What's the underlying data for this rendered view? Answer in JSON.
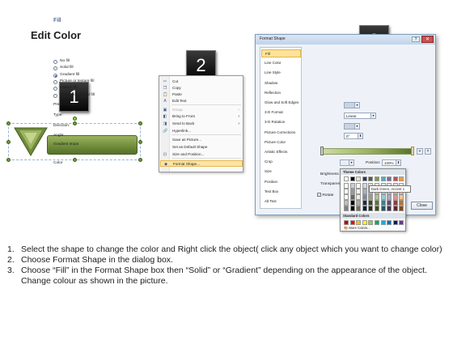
{
  "title": "Edit Color",
  "badges": [
    "1",
    "2",
    "3"
  ],
  "context_menu": {
    "items": [
      {
        "label": "Cut",
        "icon": "scissors-icon",
        "glyph": "✂",
        "submenu": false,
        "disabled": false
      },
      {
        "label": "Copy",
        "icon": "copy-icon",
        "glyph": "❐",
        "submenu": false,
        "disabled": false
      },
      {
        "label": "Paste",
        "icon": "paste-icon",
        "glyph": "📋",
        "submenu": false,
        "disabled": false
      },
      {
        "label": "Edit Text",
        "icon": "edit-text-icon",
        "glyph": "A",
        "submenu": false,
        "disabled": false
      },
      {
        "label": "Group",
        "icon": "group-icon",
        "glyph": "▣",
        "submenu": true,
        "disabled": true
      },
      {
        "label": "Bring to Front",
        "icon": "bring-to-front-icon",
        "glyph": "◧",
        "submenu": true,
        "disabled": false
      },
      {
        "label": "Send to Back",
        "icon": "send-to-back-icon",
        "glyph": "◨",
        "submenu": true,
        "disabled": false
      },
      {
        "label": "Hyperlink...",
        "icon": "hyperlink-icon",
        "glyph": "🔗",
        "submenu": false,
        "disabled": false
      },
      {
        "label": "Save as Picture...",
        "icon": "",
        "glyph": "",
        "submenu": false,
        "disabled": false
      },
      {
        "label": "Set as Default Shape",
        "icon": "",
        "glyph": "",
        "submenu": false,
        "disabled": false
      },
      {
        "label": "Size and Position...",
        "icon": "size-position-icon",
        "glyph": "⊡",
        "submenu": false,
        "disabled": false
      },
      {
        "label": "Format Shape...",
        "icon": "format-shape-icon",
        "glyph": "◆",
        "submenu": false,
        "disabled": false,
        "highlighted": true
      }
    ]
  },
  "dialog": {
    "title": "Format Shape",
    "help": "?",
    "close": "✕",
    "categories": [
      "Fill",
      "Line Color",
      "Line Style",
      "Shadow",
      "Reflection",
      "Glow and Soft Edges",
      "3-D Format",
      "3-D Rotation",
      "Picture Corrections",
      "Picture Color",
      "Artistic Effects",
      "Crop",
      "Size",
      "Position",
      "Text Box",
      "Alt Text"
    ],
    "selected_category": "Fill",
    "fill_heading": "Fill",
    "fill_options": [
      {
        "label": "No fill",
        "checked": false
      },
      {
        "label": "Solid fill",
        "checked": false
      },
      {
        "label": "Gradient fill",
        "checked": true
      },
      {
        "label": "Picture or texture fill",
        "checked": false
      },
      {
        "label": "Pattern fill",
        "checked": false
      },
      {
        "label": "Slide background fill",
        "checked": false
      }
    ],
    "preset_colors_label": "Preset colors:",
    "type_label": "Type:",
    "type_value": "Linear",
    "direction_label": "Direction:",
    "angle_label": "Angle:",
    "angle_value": "0°",
    "gradient_stops_label": "Gradient stops",
    "color_label": "Color",
    "position_label": "Position:",
    "position_value": "100%",
    "brightness_label": "Brightness",
    "transparency_label": "Transparency",
    "rotate_label": "Rotate",
    "close_button": "Close"
  },
  "palette": {
    "theme_heading": "Theme Colors",
    "standard_heading": "Standard Colors",
    "more_colors": "More Colors...",
    "tooltip": "Dark Green, Accent 1",
    "theme_colors": [
      "#ffffff",
      "#000000",
      "#e7e2c8",
      "#1f3a60",
      "#4f6228",
      "#7f9a3f",
      "#4bacc6",
      "#8064a2",
      "#c0504d",
      "#f79646"
    ],
    "standard_colors": [
      "#c00000",
      "#ff0000",
      "#ffc000",
      "#ffff00",
      "#92d050",
      "#00b050",
      "#00b0f0",
      "#0070c0",
      "#002060",
      "#7030a0"
    ]
  },
  "instructions": [
    {
      "num": "1.",
      "text": "Select the shape to change the color and Right click the object( click any object which you want to change color)"
    },
    {
      "num": "2.",
      "text": "Choose Format Shape in the dialog box."
    },
    {
      "num": "3.",
      "text": "Choose “Fill” in the Format Shape box then “Solid” or “Gradient” depending on the appearance of the object. Change colour as shown in the picture."
    }
  ]
}
